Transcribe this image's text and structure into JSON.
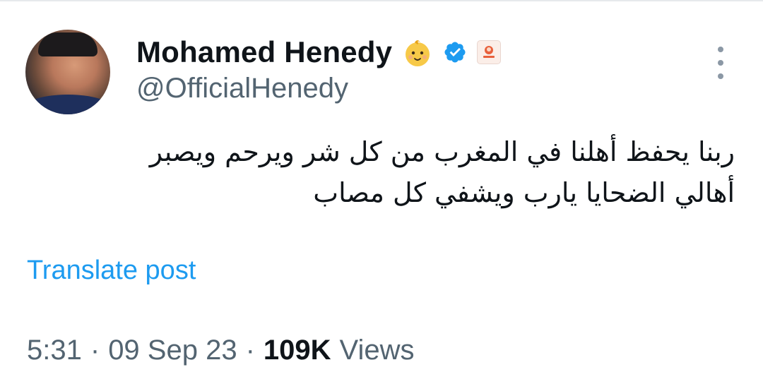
{
  "author": {
    "display_name": "Mohamed Henedy",
    "handle": "@OfficialHenedy",
    "name_emoji_icon": "baby-face-icon",
    "verified_icon": "verified-badge-icon",
    "affiliate_icon": "affiliate-badge-icon",
    "verified_color": "#1d9bf0"
  },
  "menu": {
    "more_icon": "more-vertical-icon"
  },
  "tweet": {
    "text": "ربنا يحفظ أهلنا في المغرب من كل شر  ويرحم ويصبر\nأهالي الضحايا يارب ويشفي كل مصاب",
    "translate_label": "Translate post",
    "time": "5:31",
    "separator": "·",
    "date": "09 Sep 23",
    "views_count": "109K",
    "views_label": "Views"
  },
  "colors": {
    "text_primary": "#0f1419",
    "text_secondary": "#536471",
    "link": "#1d9bf0"
  }
}
